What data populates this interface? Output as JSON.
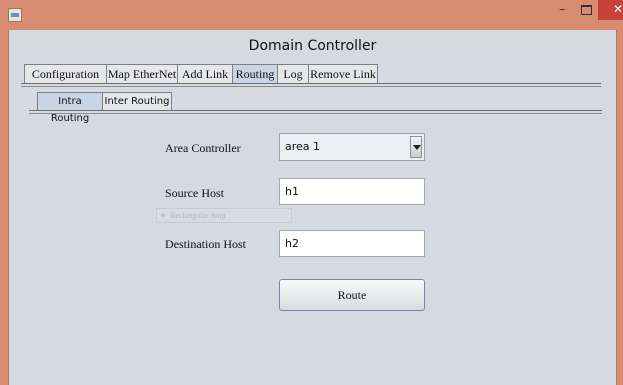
{
  "window": {
    "minimize_label": "–",
    "close_label": "✕"
  },
  "app": {
    "title": "Domain Controller"
  },
  "tabs": [
    {
      "label": "Configuration"
    },
    {
      "label": "Map EtherNet"
    },
    {
      "label": "Add Link"
    },
    {
      "label": "Routing"
    },
    {
      "label": "Log"
    },
    {
      "label": "Remove Link"
    }
  ],
  "subtabs": [
    {
      "label": "Intra Routing"
    },
    {
      "label": "Inter Routing"
    }
  ],
  "form": {
    "area_controller_label": "Area Controller",
    "area_controller_value": "area 1",
    "source_host_label": "Source Host",
    "source_host_value": "h1",
    "destination_host_label": "Destination Host",
    "destination_host_value": "h2",
    "route_button_label": "Route"
  },
  "overlay": {
    "snip_label": "Rectangular Snip"
  }
}
